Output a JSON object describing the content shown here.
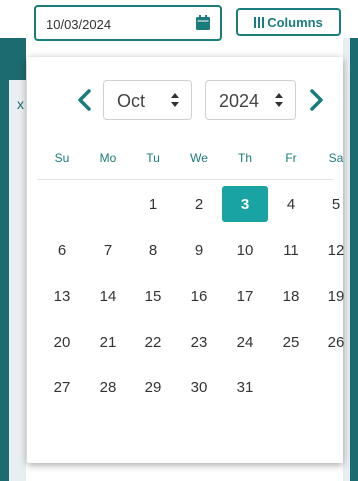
{
  "date_input": {
    "value": "10/03/2024",
    "icon": "calendar-icon"
  },
  "columns_button": {
    "label": "Columns",
    "icon": "columns-icon"
  },
  "background": {
    "left_mark": "x"
  },
  "calendar": {
    "month": "Oct",
    "year": "2024",
    "weekdays": [
      "Su",
      "Mo",
      "Tu",
      "We",
      "Th",
      "Fr",
      "Sa"
    ],
    "weeks": [
      [
        "",
        "",
        "1",
        "2",
        "3",
        "4",
        "5"
      ],
      [
        "6",
        "7",
        "8",
        "9",
        "10",
        "11",
        "12"
      ],
      [
        "13",
        "14",
        "15",
        "16",
        "17",
        "18",
        "19"
      ],
      [
        "20",
        "21",
        "22",
        "23",
        "24",
        "25",
        "26"
      ],
      [
        "27",
        "28",
        "29",
        "30",
        "31",
        "",
        ""
      ]
    ],
    "selected_day": "3"
  },
  "colors": {
    "accent": "#1b7c7c",
    "selected": "#1aa3a3",
    "background_teal": "#1c6b70"
  }
}
